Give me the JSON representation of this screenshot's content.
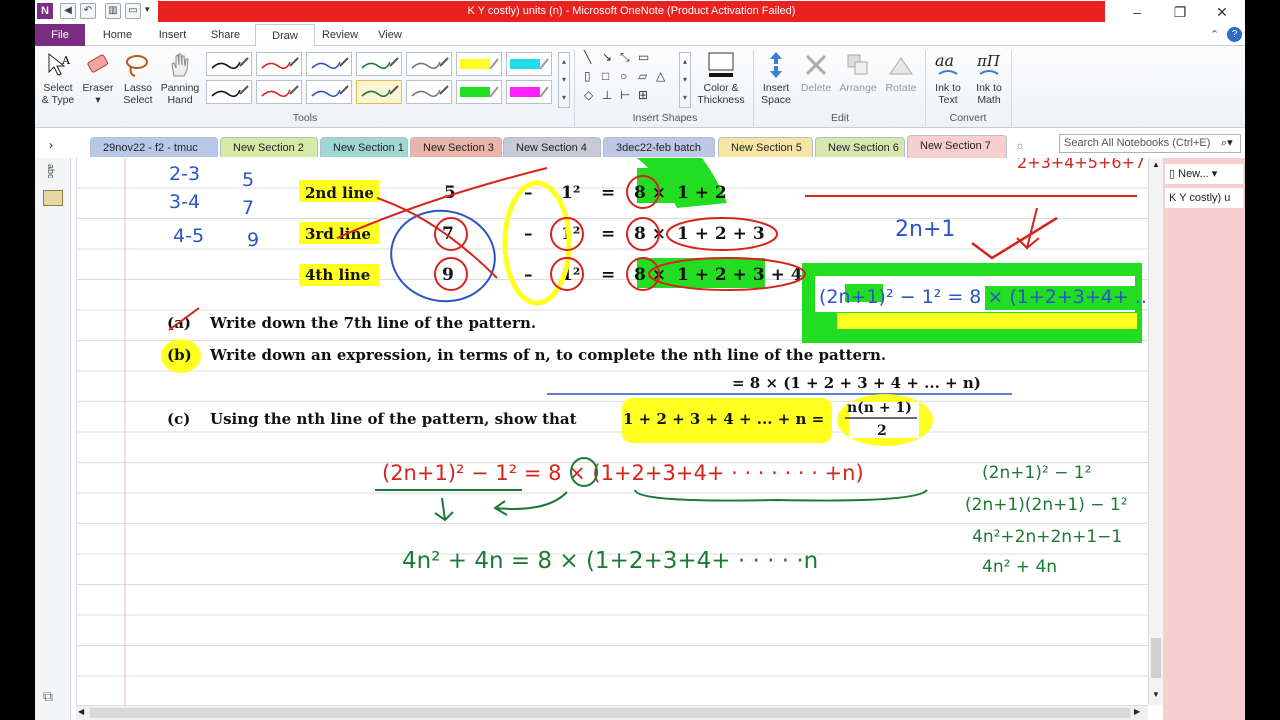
{
  "window": {
    "title": "K Y costly) units (n)  -  Microsoft OneNote (Product Activation Failed)",
    "minimize": "–",
    "maximize": "❐",
    "close": "✕"
  },
  "ribbon_tabs": [
    "File",
    "Home",
    "Insert",
    "Share",
    "Draw",
    "Review",
    "View"
  ],
  "ribbon": {
    "select_type": [
      "Select",
      "& Type"
    ],
    "eraser": "Eraser",
    "lasso": [
      "Lasso",
      "Select"
    ],
    "panning": [
      "Panning",
      "Hand"
    ],
    "tools_label": "Tools",
    "color_thickness": [
      "Color &",
      "Thickness"
    ],
    "insert_shapes_label": "Insert Shapes",
    "insert_space": [
      "Insert",
      "Space"
    ],
    "delete": "Delete",
    "arrange": "Arrange",
    "rotate": "Rotate",
    "edit_label": "Edit",
    "ink_to_text": [
      "Ink to",
      "Text"
    ],
    "ink_to_math": [
      "Ink to",
      "Math"
    ],
    "convert_label": "Convert"
  },
  "sections": [
    {
      "label": "29nov22 - f2 - tmuc",
      "color": "#b8c9e8"
    },
    {
      "label": "New Section 2",
      "color": "#d6eaa8"
    },
    {
      "label": "New Section 1",
      "color": "#9fd7d6"
    },
    {
      "label": "New Section 3",
      "color": "#e9b4ab"
    },
    {
      "label": "New Section 4",
      "color": "#c8c9d6"
    },
    {
      "label": "3dec22-feb batch",
      "color": "#bcc9e6"
    },
    {
      "label": "New Section 5",
      "color": "#f6e6a6"
    },
    {
      "label": "New Section 6",
      "color": "#d6e8b0"
    },
    {
      "label": "New Section 7",
      "color": "#f4c8c8"
    }
  ],
  "search_placeholder": "Search All Notebooks (Ctrl+E)",
  "pages": {
    "new_page": "New...",
    "current_page": "K Y costly) u"
  },
  "content": {
    "left_notes": [
      "2-3",
      "3-4",
      "4-5"
    ],
    "left_vals": [
      "5",
      "7",
      "9"
    ],
    "lines": [
      {
        "label": "2nd line",
        "sq": "5",
        "sum": "1 + 2"
      },
      {
        "label": "3rd line",
        "sq": "7",
        "sum": "1 + 2 + 3"
      },
      {
        "label": "4th line",
        "sq": "9",
        "sum": "1 + 2 + 3 + 4"
      }
    ],
    "q_a_letter": "(a)",
    "q_a": "Write down the 7th line of the pattern.",
    "q_b_letter": "(b)",
    "q_b": "Write down an expression, in terms of n, to complete the nth line of the pattern.",
    "q_b_answer": "= 8 × (1 + 2 + 3 + 4 +  ... + n)",
    "q_c_letter": "(c)",
    "q_c": "Using the nth line of the pattern, show that",
    "q_c_sum": "1 + 2 + 3 + 4 + ... + n =",
    "q_c_frac_num": "n(n + 1)",
    "q_c_frac_den": "2",
    "hand_2n1": "2n+1",
    "hand_top_right": "2+3+4+5+6+7",
    "hand_general": "(2n+1)² − 1² = 8 × (1+2+3+4+ .....n)",
    "hand_work_line1": "(2n+1)² − 1²  = 8 × (1+2+3+4+ · · · · · · · +n)",
    "hand_work_line2": "4n² + 4n  =  8 × (1+2+3+4+ · · · · ·n",
    "hand_right": [
      "(2n+1)² − 1²",
      "(2n+1)(2n+1) − 1²",
      "4n²+2n+2n+1−1",
      "4n² + 4n"
    ]
  }
}
